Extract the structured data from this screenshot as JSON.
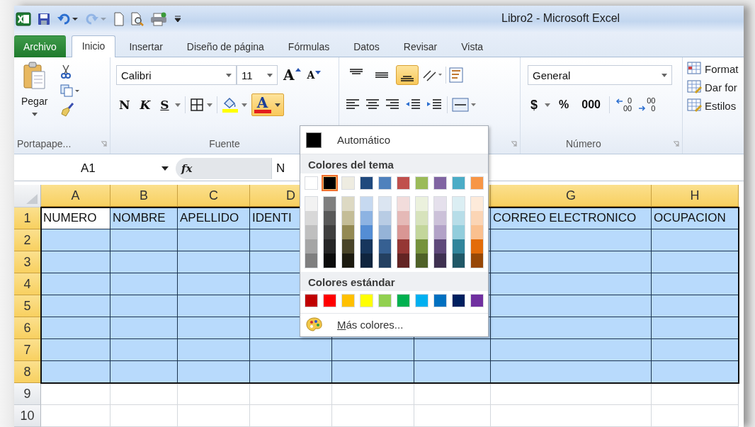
{
  "window": {
    "title": "Libro2  -  Microsoft Excel"
  },
  "quick_access": [
    {
      "kind": "logo",
      "disabled": false
    },
    {
      "kind": "save",
      "disabled": false
    },
    {
      "kind": "undo",
      "disabled": false
    },
    {
      "kind": "redo",
      "disabled": true
    },
    {
      "kind": "new",
      "disabled": false
    },
    {
      "kind": "preview",
      "disabled": false
    },
    {
      "kind": "print",
      "disabled": false
    },
    {
      "kind": "customize",
      "disabled": false
    }
  ],
  "tabs": [
    {
      "label": "Archivo",
      "kind": "file",
      "selected": false
    },
    {
      "label": "Inicio",
      "kind": "tab",
      "selected": true
    },
    {
      "label": "Insertar",
      "kind": "tab",
      "selected": false
    },
    {
      "label": "Diseño de página",
      "kind": "tab",
      "selected": false
    },
    {
      "label": "Fórmulas",
      "kind": "tab",
      "selected": false
    },
    {
      "label": "Datos",
      "kind": "tab",
      "selected": false
    },
    {
      "label": "Revisar",
      "kind": "tab",
      "selected": false
    },
    {
      "label": "Vista",
      "kind": "tab",
      "selected": false
    }
  ],
  "ribbon": {
    "clipboard": {
      "paste": "Pegar",
      "group_label": "Portapape..."
    },
    "font": {
      "family": "Calibri",
      "size": "11",
      "grow": "A",
      "shrink": "A",
      "bold": "N",
      "italic": "K",
      "underline": "S",
      "font_color": "A",
      "font_color_open": true,
      "group_label": "Fuente"
    },
    "alignment": {
      "vertical": [
        {
          "kind": "top",
          "selected": false
        },
        {
          "kind": "middle",
          "selected": false
        },
        {
          "kind": "bottom",
          "selected": true
        }
      ]
    },
    "number": {
      "format": "General",
      "currency": "$",
      "percent": "%",
      "thousands": "000",
      "decimals": [
        {
          "kind": "increase",
          "upper": "0",
          "lower": "00"
        },
        {
          "kind": "decrease",
          "upper": "00",
          "lower": "0"
        }
      ],
      "group_label": "Número"
    },
    "styles": {
      "items": [
        "Format",
        "Dar for",
        "Estilos"
      ]
    }
  },
  "formula_bar": {
    "name_box": "A1",
    "fx": "fx",
    "content": "N"
  },
  "sheet": {
    "columns": [
      {
        "label": "A"
      },
      {
        "label": "B"
      },
      {
        "label": "C"
      },
      {
        "label": "D"
      },
      {},
      {},
      {
        "label": "G"
      },
      {
        "label": "H"
      }
    ],
    "rows": [
      {
        "header": "1",
        "selected": true,
        "cells": [
          {
            "text": "NUMERO",
            "active": true
          },
          {
            "text": "NOMBRE",
            "active": false
          },
          {
            "text": "APELLIDO",
            "active": false
          },
          {
            "text": "IDENTI",
            "active": false
          },
          {},
          {},
          {
            "text": "CORREO ELECTRONICO",
            "active": false
          },
          {
            "text": "OCUPACION",
            "active": false
          }
        ]
      },
      {
        "header": "2",
        "selected": true
      },
      {
        "header": "3",
        "selected": true
      },
      {
        "header": "4",
        "selected": true
      },
      {
        "header": "5",
        "selected": true
      },
      {
        "header": "6",
        "selected": true
      },
      {
        "header": "7",
        "selected": true
      },
      {
        "header": "8",
        "selected": true
      },
      {
        "header": "9",
        "selected": false
      },
      {
        "header": "10",
        "selected": false
      }
    ]
  },
  "color_menu": {
    "automatic": {
      "label": "Automático",
      "color": "#000000"
    },
    "theme_title": "Colores del tema",
    "theme": [
      {
        "color": "#ffffff",
        "selected": false,
        "shades": [
          {
            "color": "#f2f2f2",
            "selected": false
          },
          {
            "color": "#d8d8d8",
            "selected": false
          },
          {
            "color": "#bfbfbf",
            "selected": false
          },
          {
            "color": "#a5a5a5",
            "selected": false
          },
          {
            "color": "#7f7f7f",
            "selected": false
          }
        ]
      },
      {
        "color": "#000000",
        "selected": true,
        "shades": [
          {
            "color": "#7f7f7f",
            "selected": false
          },
          {
            "color": "#595959",
            "selected": false
          },
          {
            "color": "#3f3f3f",
            "selected": false
          },
          {
            "color": "#262626",
            "selected": false
          },
          {
            "color": "#0c0c0c",
            "selected": false
          }
        ]
      },
      {
        "color": "#eeece1",
        "selected": false,
        "shades": [
          {
            "color": "#ddd9c3",
            "selected": false
          },
          {
            "color": "#c4bd97",
            "selected": false
          },
          {
            "color": "#938953",
            "selected": false
          },
          {
            "color": "#494429",
            "selected": false
          },
          {
            "color": "#1d1b10",
            "selected": false
          }
        ]
      },
      {
        "color": "#1f497d",
        "selected": false,
        "shades": [
          {
            "color": "#c6d9f0",
            "selected": false
          },
          {
            "color": "#8db3e2",
            "selected": false
          },
          {
            "color": "#548dd4",
            "selected": false
          },
          {
            "color": "#17365d",
            "selected": false
          },
          {
            "color": "#0f243e",
            "selected": false
          }
        ]
      },
      {
        "color": "#4f81bd",
        "selected": false,
        "shades": [
          {
            "color": "#dbe5f1",
            "selected": false
          },
          {
            "color": "#b8cce4",
            "selected": false
          },
          {
            "color": "#95b3d7",
            "selected": false
          },
          {
            "color": "#366092",
            "selected": false
          },
          {
            "color": "#244061",
            "selected": false
          }
        ]
      },
      {
        "color": "#c0504d",
        "selected": false,
        "shades": [
          {
            "color": "#f2dcdb",
            "selected": false
          },
          {
            "color": "#e5b9b7",
            "selected": false
          },
          {
            "color": "#d99694",
            "selected": false
          },
          {
            "color": "#953734",
            "selected": false
          },
          {
            "color": "#632423",
            "selected": false
          }
        ]
      },
      {
        "color": "#9bbb59",
        "selected": false,
        "shades": [
          {
            "color": "#ebf1dd",
            "selected": false
          },
          {
            "color": "#d7e3bc",
            "selected": false
          },
          {
            "color": "#c3d69b",
            "selected": false
          },
          {
            "color": "#76923c",
            "selected": false
          },
          {
            "color": "#4f6128",
            "selected": false
          }
        ]
      },
      {
        "color": "#8064a2",
        "selected": false,
        "shades": [
          {
            "color": "#e5e0ec",
            "selected": false
          },
          {
            "color": "#ccc1d9",
            "selected": false
          },
          {
            "color": "#b2a2c7",
            "selected": false
          },
          {
            "color": "#5f497a",
            "selected": false
          },
          {
            "color": "#3f3151",
            "selected": false
          }
        ]
      },
      {
        "color": "#4bacc6",
        "selected": false,
        "shades": [
          {
            "color": "#dbeef3",
            "selected": false
          },
          {
            "color": "#b7dde8",
            "selected": false
          },
          {
            "color": "#92cddc",
            "selected": false
          },
          {
            "color": "#31859b",
            "selected": false
          },
          {
            "color": "#205867",
            "selected": false
          }
        ]
      },
      {
        "color": "#f79646",
        "selected": false,
        "shades": [
          {
            "color": "#fdeada",
            "selected": false
          },
          {
            "color": "#fbd5b5",
            "selected": false
          },
          {
            "color": "#fac08f",
            "selected": false
          },
          {
            "color": "#e36c09",
            "selected": false
          },
          {
            "color": "#974806",
            "selected": false
          }
        ]
      }
    ],
    "standard_title": "Colores estándar",
    "standard": [
      {
        "color": "#c00000",
        "selected": false
      },
      {
        "color": "#ff0000",
        "selected": false
      },
      {
        "color": "#ffc000",
        "selected": false
      },
      {
        "color": "#ffff00",
        "selected": false
      },
      {
        "color": "#92d050",
        "selected": false
      },
      {
        "color": "#00b050",
        "selected": false
      },
      {
        "color": "#00b0f0",
        "selected": false
      },
      {
        "color": "#0070c0",
        "selected": false
      },
      {
        "color": "#002060",
        "selected": false
      },
      {
        "color": "#7030a0",
        "selected": false
      }
    ],
    "more": {
      "accel": "M",
      "rest": "ás colores..."
    }
  }
}
